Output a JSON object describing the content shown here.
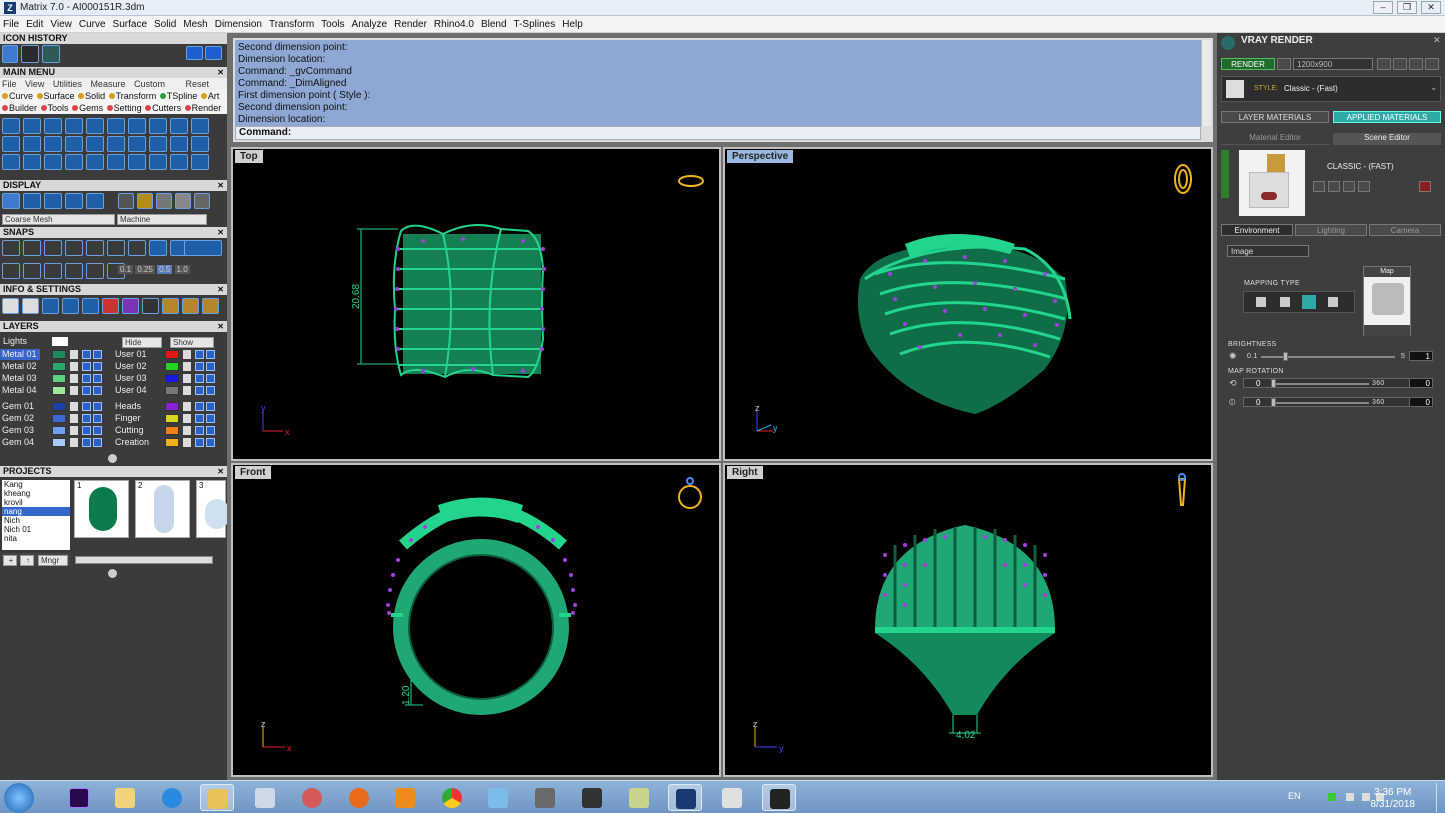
{
  "window": {
    "app_icon": "Z",
    "title": "Matrix 7.0 - AI000151R.3dm"
  },
  "menu": [
    "File",
    "Edit",
    "View",
    "Curve",
    "Surface",
    "Solid",
    "Mesh",
    "Dimension",
    "Transform",
    "Tools",
    "Analyze",
    "Render",
    "Rhino4.0",
    "Blend",
    "T-Splines",
    "Help"
  ],
  "left": {
    "icon_history": "ICON HISTORY",
    "main_menu": "MAIN MENU",
    "main_tabs": [
      "File",
      "View",
      "Utilities",
      "Measure",
      "Custom"
    ],
    "main_reset": "Reset",
    "main_row1": [
      "Curve",
      "Surface",
      "Solid",
      "Transform",
      "TSpline",
      "Art"
    ],
    "main_row2": [
      "Builder",
      "Tools",
      "Gems",
      "Setting",
      "Cutters",
      "Render"
    ],
    "display": "DISPLAY",
    "display_mesh": "Coarse Mesh",
    "display_machine": "Machine",
    "snaps": "SNAPS",
    "snap_values": [
      "0.1",
      "0.25",
      "0.5",
      "1.0"
    ],
    "info": "INFO & SETTINGS",
    "layers": "LAYERS",
    "lights": "Lights",
    "hide": "Hide",
    "show": "Show",
    "layers_left": [
      "Metal 01",
      "Metal 02",
      "Metal 03",
      "Metal 04",
      "Gem 01",
      "Gem 02",
      "Gem 03",
      "Gem 04"
    ],
    "layers_right": [
      "User 01",
      "User 02",
      "User 03",
      "User 04",
      "Heads",
      "Finger",
      "Cutting",
      "Creation"
    ],
    "projects": "PROJECTS",
    "project_names": [
      "Kang",
      "kheang",
      "krovil",
      "nang",
      "Nich",
      "Nich 01",
      "nita"
    ],
    "thumb_nums": [
      "1",
      "2",
      "3"
    ],
    "mngr": "Mngr"
  },
  "command": {
    "log": [
      "Second dimension point:",
      "Dimension location:",
      "Command: _gvCommand",
      "Command: _DimAligned",
      "First dimension point ( Style ):",
      "Second dimension point:",
      "Dimension location:"
    ],
    "prompt": "Command:"
  },
  "viewports": {
    "top": {
      "label": "Top",
      "dim": "20.68"
    },
    "perspective": {
      "label": "Perspective"
    },
    "front": {
      "label": "Front",
      "dim": "1.20"
    },
    "right": {
      "label": "Right",
      "dim": "4.02"
    },
    "axis": {
      "x": "x",
      "y": "y",
      "z": "z"
    }
  },
  "vray": {
    "title": "VRAY RENDER",
    "render": "RENDER",
    "resolution": "1200x900",
    "style_label": "STYLE:",
    "style_value": "Classic - (Fast)",
    "tab_layer": "LAYER MATERIALS",
    "tab_applied": "APPLIED MATERIALS",
    "material_editor": "Material Editor",
    "scene_editor": "Scene Editor",
    "preset": "CLASSIC - (FAST)",
    "env_tabs": [
      "Environment",
      "Lighting",
      "Camera"
    ],
    "image_dropdown": "Image",
    "mapping": "MAPPING TYPE",
    "map": "Map",
    "brightness": "BRIGHTNESS",
    "bright_min": "0.1",
    "bright_max": "5",
    "bright_val": "1",
    "map_rotation": "MAP ROTATION",
    "rot_min": "0",
    "rot_max": "360",
    "rot_val": "0",
    "rot2_min": "0",
    "rot2_max": "360",
    "rot2_val": "0"
  },
  "taskbar": {
    "lang": "EN",
    "time": "3:36 PM",
    "date": "8/31/2018"
  }
}
